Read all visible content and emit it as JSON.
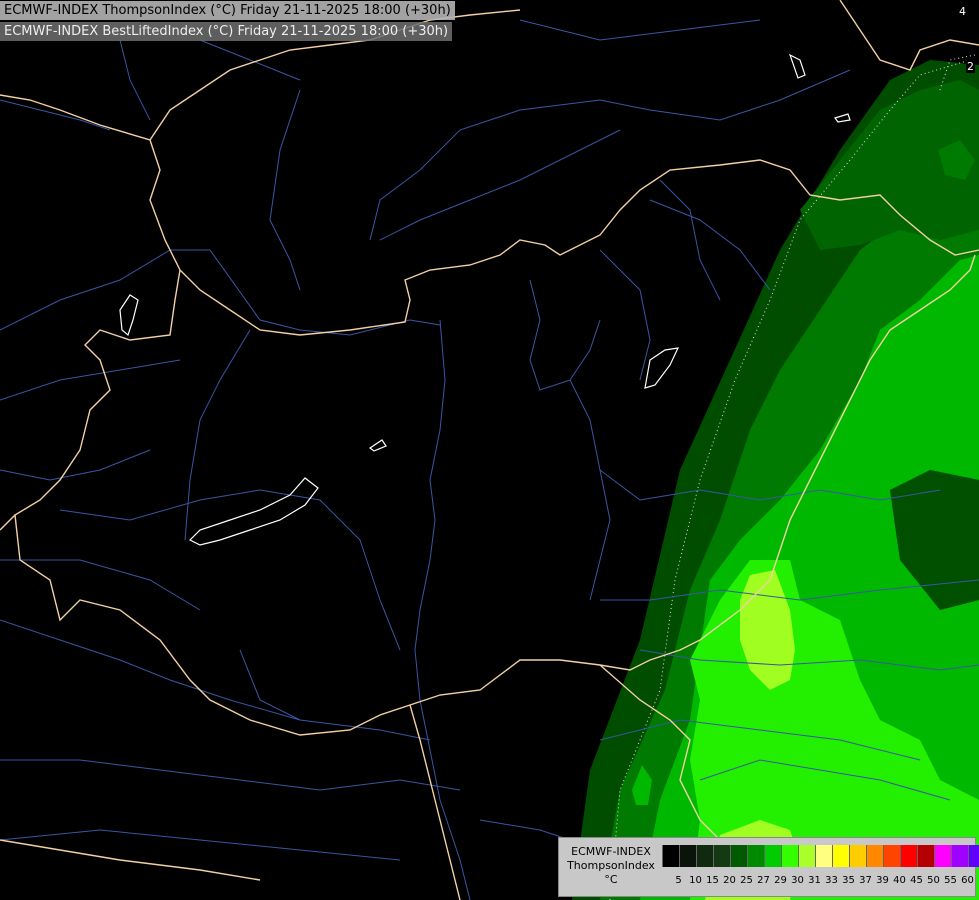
{
  "header": {
    "title_primary": "ECMWF-INDEX ThompsonIndex (°C) Friday 21-11-2025 18:00 (+30h)",
    "title_secondary": "ECMWF-INDEX BestLiftedIndex (°C) Friday 21-11-2025 18:00 (+30h)"
  },
  "map": {
    "contour_labels": [
      "4",
      "2"
    ],
    "colors": {
      "background": "#000000",
      "border": "#f5d4a8",
      "river": "#3c5aa8",
      "lake": "#ffffff",
      "band_25": "#005a00",
      "band_27": "#008a00",
      "band_29": "#00cc00",
      "band_30": "#33ff00",
      "band_31": "#a8ff2a"
    }
  },
  "legend": {
    "model": "ECMWF-INDEX",
    "parameter": "ThompsonIndex",
    "unit": "°C",
    "ticks": [
      "5",
      "10",
      "15",
      "20",
      "25",
      "27",
      "29",
      "30",
      "31",
      "33",
      "35",
      "37",
      "39",
      "40",
      "45",
      "50",
      "55",
      "60"
    ],
    "colors": [
      "#000000",
      "#0a140a",
      "#0f2a0f",
      "#133a13",
      "#005a00",
      "#008a00",
      "#00cc00",
      "#33ff00",
      "#a8ff2a",
      "#ffff80",
      "#ffff00",
      "#ffcc00",
      "#ff8800",
      "#ff4400",
      "#ff0000",
      "#b40000",
      "#ff00ff",
      "#a000ff",
      "#6000ff",
      "#0000ff"
    ]
  }
}
